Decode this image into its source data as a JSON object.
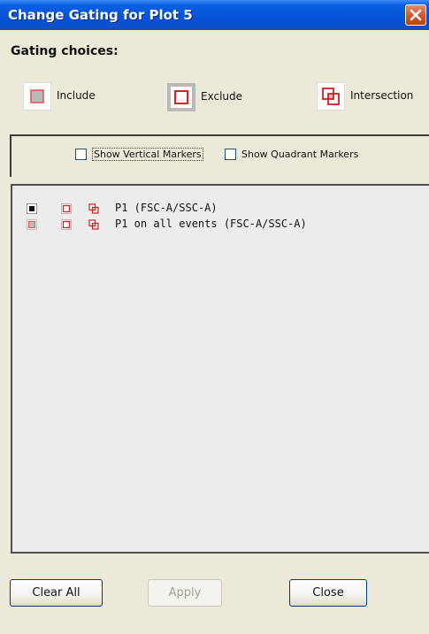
{
  "window": {
    "title": "Change Gating for Plot 5",
    "close_icon": "close-icon"
  },
  "gating": {
    "heading": "Gating choices:",
    "choices": [
      {
        "label": "Include",
        "icon": "include-icon"
      },
      {
        "label": "Exclude",
        "icon": "exclude-icon"
      },
      {
        "label": "Intersection",
        "icon": "intersection-icon"
      }
    ]
  },
  "markers": {
    "vertical": {
      "label": "Show Vertical Markers",
      "checked": false
    },
    "quadrant": {
      "label": "Show Quadrant Markers",
      "checked": false
    }
  },
  "gates": [
    {
      "label": "P1 (FSC-A/SSC-A)",
      "include_active": true
    },
    {
      "label": "P1 on all events (FSC-A/SSC-A)",
      "include_active": false
    }
  ],
  "buttons": {
    "clear_all": "Clear All",
    "apply": "Apply",
    "close": "Close"
  },
  "colors": {
    "titlebar": "#0552d8",
    "dialog_bg": "#ece9d8",
    "gate_red": "#e03030"
  }
}
